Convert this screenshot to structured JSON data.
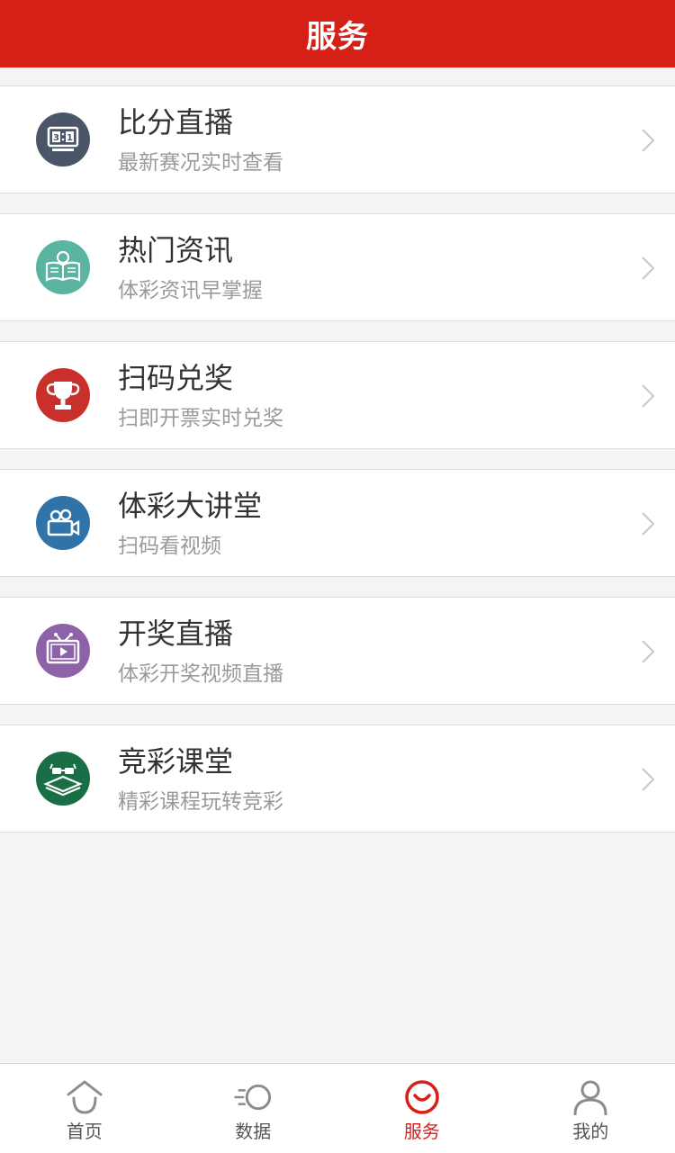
{
  "header": {
    "title": "服务"
  },
  "colors": {
    "brand": "#d61f17",
    "tab_inactive": "#8c8c8c"
  },
  "services": [
    {
      "title": "比分直播",
      "subtitle": "最新赛况实时查看",
      "icon": "scoreboard-icon",
      "icon_color": "#4a5568"
    },
    {
      "title": "热门资讯",
      "subtitle": "体彩资讯早掌握",
      "icon": "book-lightbulb-icon",
      "icon_color": "#5bb4a0"
    },
    {
      "title": "扫码兑奖",
      "subtitle": "扫即开票实时兑奖",
      "icon": "trophy-icon",
      "icon_color": "#c9302c"
    },
    {
      "title": "体彩大讲堂",
      "subtitle": "扫码看视频",
      "icon": "video-camera-icon",
      "icon_color": "#2f73a8"
    },
    {
      "title": "开奖直播",
      "subtitle": "体彩开奖视频直播",
      "icon": "tv-play-icon",
      "icon_color": "#8e62a8"
    },
    {
      "title": "竞彩课堂",
      "subtitle": "精彩课程玩转竞彩",
      "icon": "books-glasses-icon",
      "icon_color": "#1a6e45"
    }
  ],
  "tabbar": {
    "items": [
      {
        "label": "首页",
        "icon": "home-icon",
        "active": false
      },
      {
        "label": "数据",
        "icon": "data-icon",
        "active": false
      },
      {
        "label": "服务",
        "icon": "smile-icon",
        "active": true
      },
      {
        "label": "我的",
        "icon": "user-icon",
        "active": false
      }
    ]
  }
}
